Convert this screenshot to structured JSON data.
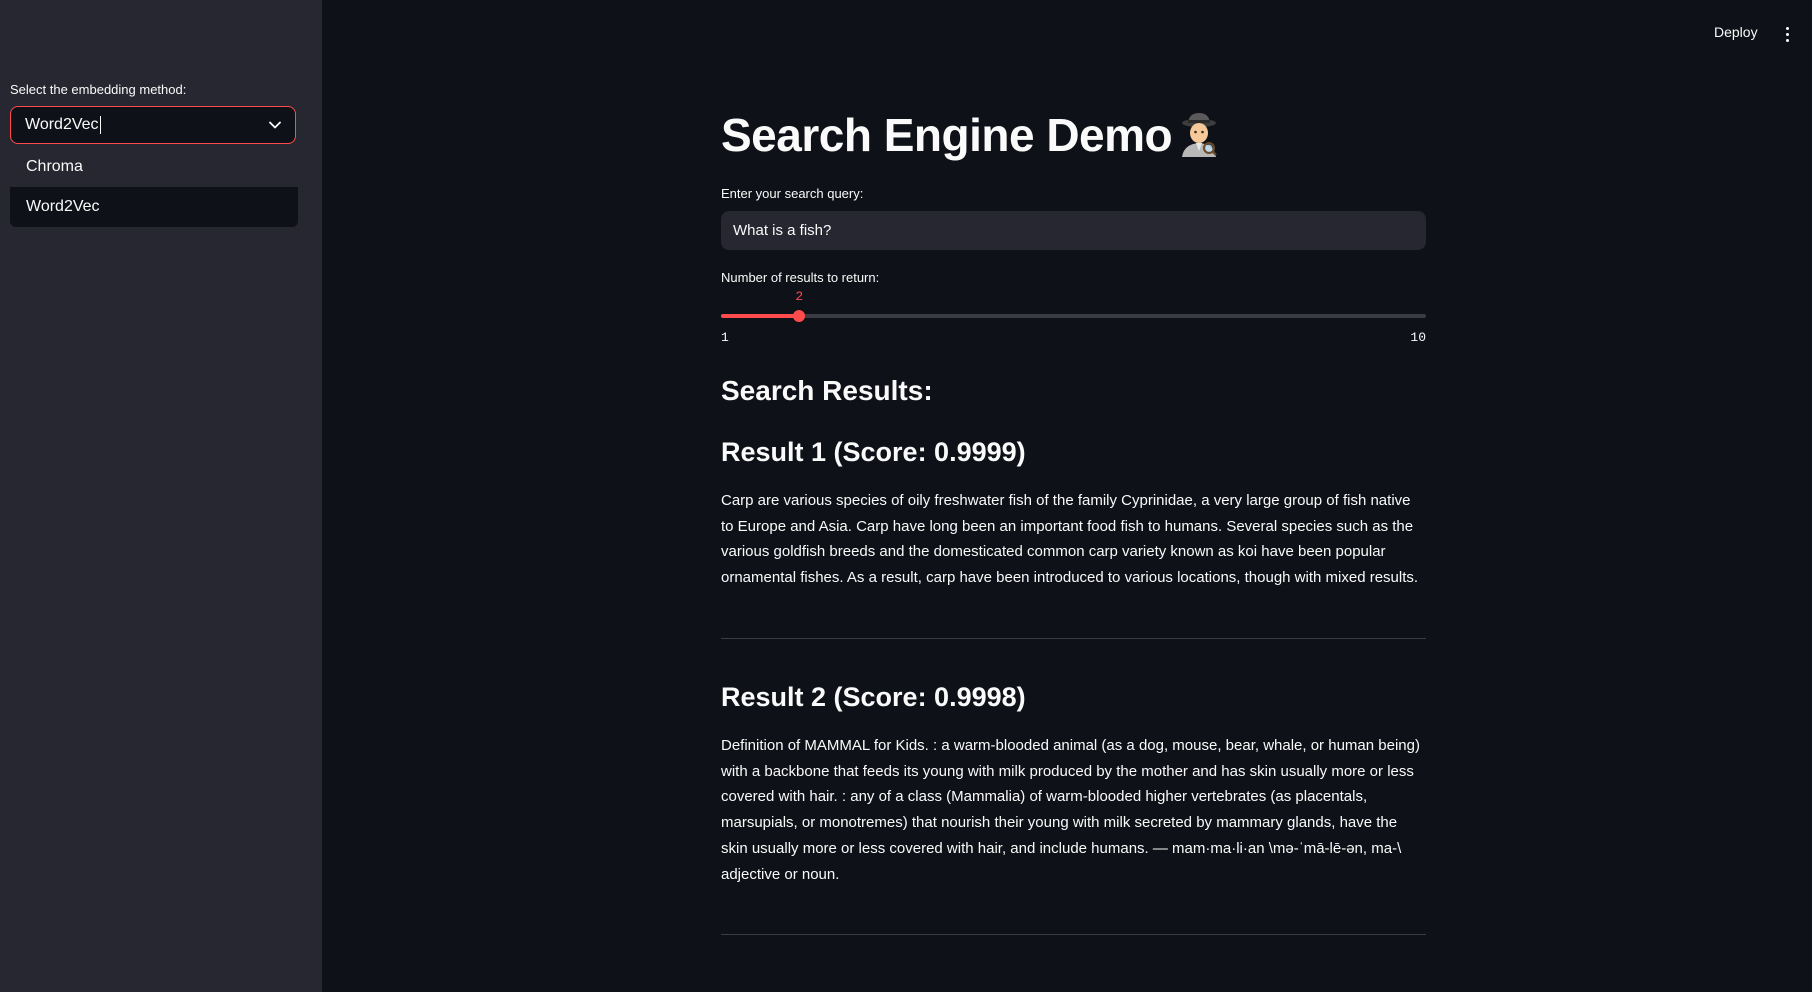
{
  "sidebar": {
    "select_label": "Select the embedding method:",
    "selected_value": "Word2Vec",
    "options": [
      "Chroma",
      "Word2Vec"
    ]
  },
  "header": {
    "deploy_label": "Deploy"
  },
  "main": {
    "title": "Search Engine Demo",
    "query_label": "Enter your search query:",
    "query_value": "What is a fish?",
    "slider": {
      "label": "Number of results to return:",
      "value": 2,
      "min": 1,
      "max": 10
    },
    "results_heading": "Search Results:",
    "results": [
      {
        "heading": "Result 1 (Score: 0.9999)",
        "text": "Carp are various species of oily freshwater fish of the family Cyprinidae, a very large group of fish native to Europe and Asia. Carp have long been an important food fish to humans. Several species such as the various goldfish breeds and the domesticated common carp variety known as koi have been popular ornamental fishes. As a result, carp have been introduced to various locations, though with mixed results."
      },
      {
        "heading": "Result 2 (Score: 0.9998)",
        "text": "Definition of MAMMAL for Kids. : a warm-blooded animal (as a dog, mouse, bear, whale, or human being) with a backbone that feeds its young with milk produced by the mother and has skin usually more or less covered with hair. : any of a class (Mammalia) of warm-blooded higher vertebrates (as placentals, marsupials, or monotremes) that nourish their young with milk secreted by mammary glands, have the skin usually more or less covered with hair, and include humans. — mam·ma·li·an \\mə-ˈmā-lē-ən, ma-\\ adjective or noun."
      }
    ]
  },
  "colors": {
    "accent": "#ff4b4b",
    "background": "#0e1117",
    "sidebar": "#262730"
  },
  "icons": [
    "chevron-down-icon",
    "more-vertical-icon",
    "detective-emoji-icon"
  ]
}
